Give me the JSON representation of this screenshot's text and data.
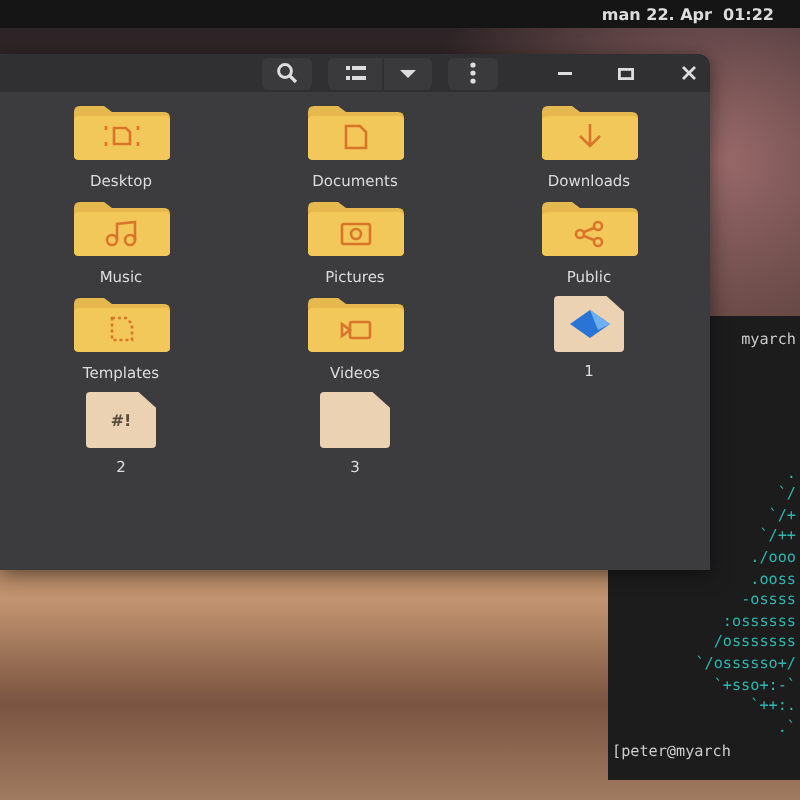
{
  "top_bar": {
    "clock": "man 22. Apr  01:22"
  },
  "file_window": {
    "items": [
      {
        "name": "Desktop",
        "kind": "desktop"
      },
      {
        "name": "Documents",
        "kind": "documents"
      },
      {
        "name": "Downloads",
        "kind": "downloads"
      },
      {
        "name": "Music",
        "kind": "music"
      },
      {
        "name": "Pictures",
        "kind": "pictures"
      },
      {
        "name": "Public",
        "kind": "public"
      },
      {
        "name": "Templates",
        "kind": "templates"
      },
      {
        "name": "Videos",
        "kind": "videos"
      },
      {
        "name": "1",
        "kind": "app"
      },
      {
        "name": "2",
        "kind": "script",
        "glyph": "#!"
      },
      {
        "name": "3",
        "kind": "blank"
      }
    ]
  },
  "terminal": {
    "title_fragment": "myarch",
    "logo_lines": [
      ".",
      "`/",
      "`/+",
      "`/++",
      "./ooo",
      ".ooss",
      "-ossss",
      ":ossssss",
      "/osssssss",
      "`/ossssso+/",
      "`+sso+:-`",
      "`++:.",
      ".`"
    ],
    "prompt": "[peter@myarch"
  }
}
